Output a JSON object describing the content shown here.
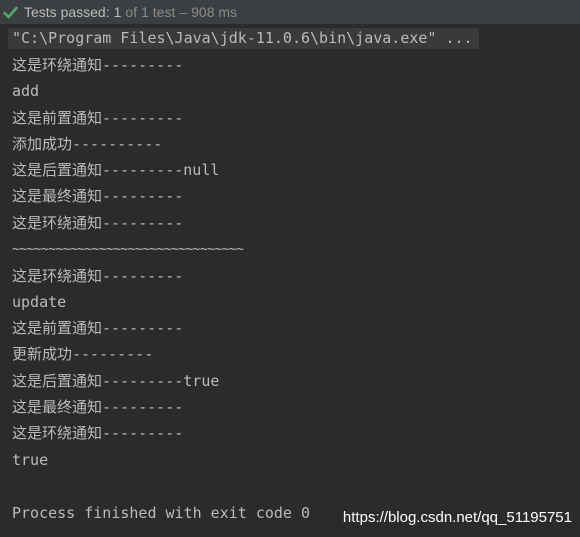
{
  "status_bar": {
    "label": "Tests passed:",
    "passed": "1",
    "of": "of",
    "total": "1 test",
    "separator": "–",
    "time": "908 ms",
    "icon": "check-icon",
    "icon_color": "#59a869"
  },
  "console": {
    "command": "\"C:\\Program Files\\Java\\jdk-11.0.6\\bin\\java.exe\" ...",
    "lines": [
      "这是环绕通知---------",
      "add",
      "这是前置通知---------",
      "添加成功----------",
      "这是后置通知---------null",
      "这是最终通知---------",
      "这是环绕通知---------",
      "~~~~~~~~~~~~~~~~~~~~~~~~~~~~~~~~",
      "这是环绕通知---------",
      "update",
      "这是前置通知---------",
      "更新成功---------",
      "这是后置通知---------true",
      "这是最终通知---------",
      "这是环绕通知---------",
      "true",
      "",
      "Process finished with exit code 0"
    ]
  },
  "watermark": "https://blog.csdn.net/qq_51195751"
}
